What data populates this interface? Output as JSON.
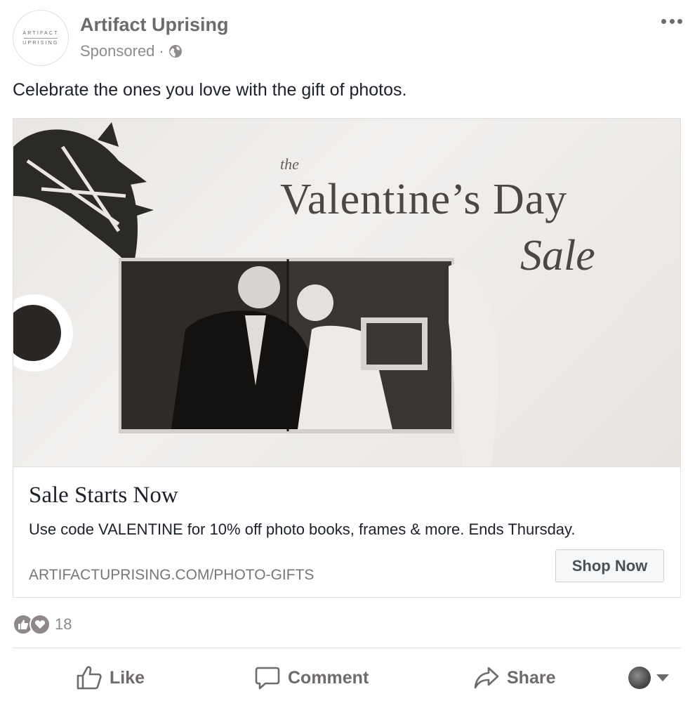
{
  "post": {
    "page_name": "Artifact Uprising",
    "avatar_logo": {
      "line1": "ARTIFACT",
      "line2": "UPRISING"
    },
    "sponsored_label": "Sponsored",
    "separator": "·",
    "audience_icon": "globe-icon",
    "more_icon": "more-options-icon",
    "text": "Celebrate the ones you love with the gift of photos."
  },
  "creative": {
    "headline_the": "the",
    "headline_main": "Valentine’s Day",
    "headline_sale": "Sale"
  },
  "link_card": {
    "title": "Sale Starts Now",
    "description": "Use code VALENTINE for 10% off photo books, frames & more. Ends Thursday.",
    "url": "ARTIFACTUPRISING.COM/PHOTO-GIFTS",
    "cta_label": "Shop Now"
  },
  "reactions": {
    "icons": [
      "like-reaction-icon",
      "love-reaction-icon"
    ],
    "count": "18"
  },
  "actions": {
    "like_label": "Like",
    "comment_label": "Comment",
    "share_label": "Share"
  },
  "colors": {
    "text_primary": "#1d2129",
    "text_muted": "#8f8a8c",
    "header_name": "#6f6a6b",
    "border": "#dddfe2"
  }
}
